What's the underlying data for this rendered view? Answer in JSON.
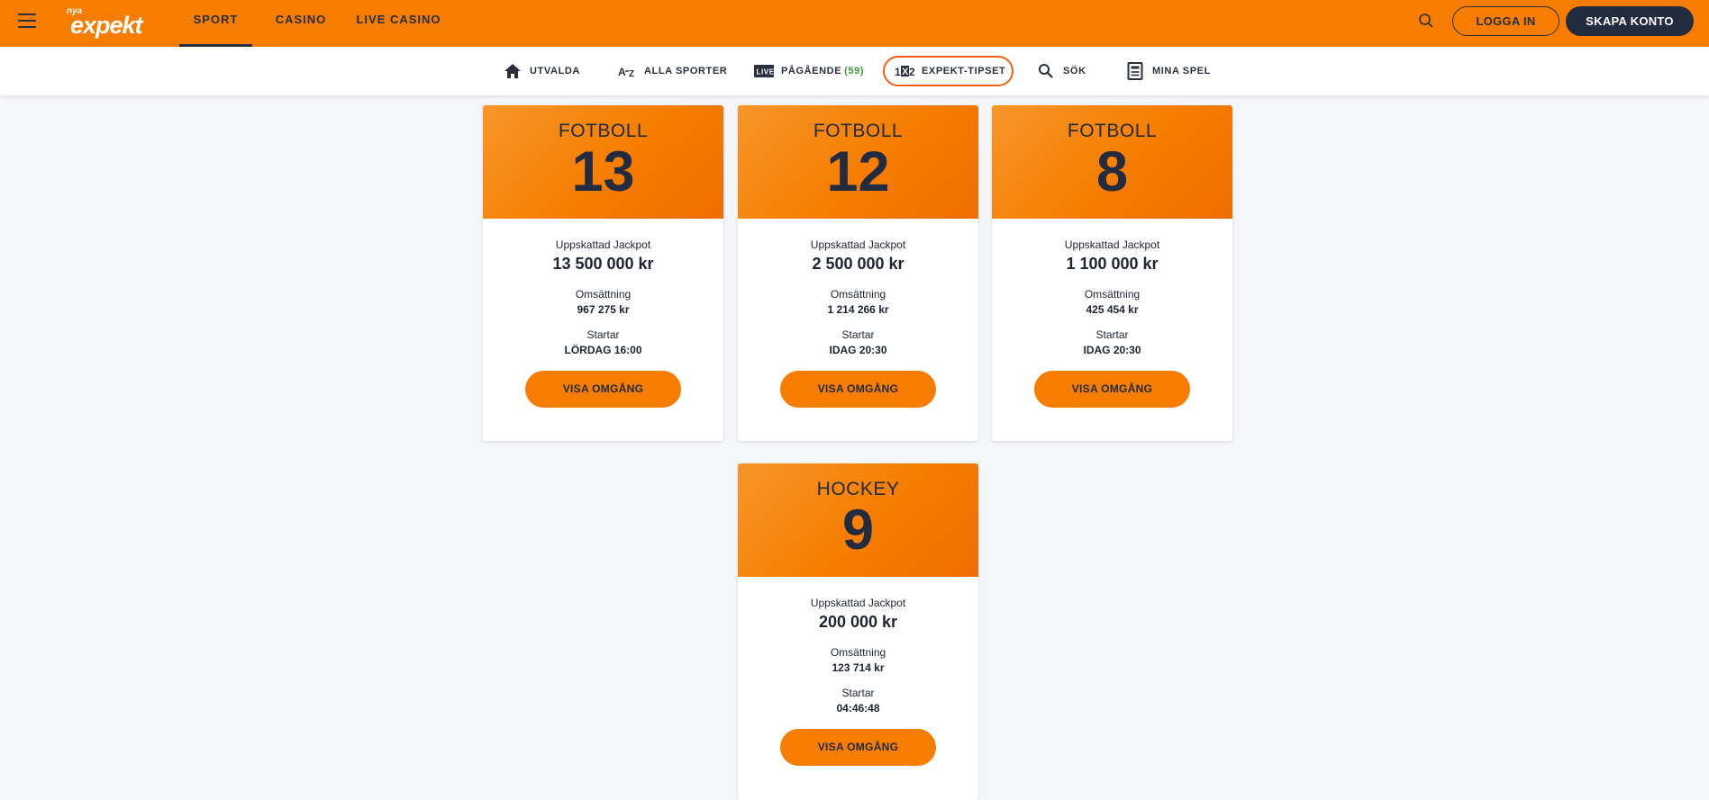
{
  "brand": {
    "prefix": "nya",
    "name": "expekt",
    "accent": "#f67d00",
    "dark": "#222b3f"
  },
  "header": {
    "tabs": [
      {
        "label": "SPORT",
        "active": true
      },
      {
        "label": "CASINO",
        "active": false
      },
      {
        "label": "LIVE CASINO",
        "active": false
      }
    ],
    "login_label": "LOGGA IN",
    "signup_label": "SKAPA KONTO"
  },
  "subnav": {
    "items": [
      {
        "label": "UTVALDA",
        "icon": "home-icon"
      },
      {
        "label": "ALLA SPORTER",
        "icon": "az-icon"
      },
      {
        "label": "PÅGÅENDE",
        "count": "(59)",
        "icon": "live-icon"
      },
      {
        "label": "EXPEKT-TIPSET",
        "icon": "1x2-icon",
        "active": true
      },
      {
        "label": "SÖK",
        "icon": "search-icon"
      },
      {
        "label": "MINA SPEL",
        "icon": "betslip-icon"
      }
    ]
  },
  "cards": [
    {
      "sport": "FOTBOLL",
      "number": "13",
      "jackpot_label": "Uppskattad Jackpot",
      "jackpot": "13 500 000 kr",
      "turnover_label": "Omsättning",
      "turnover": "967 275 kr",
      "start_label": "Startar",
      "start": "LÖRDAG 16:00",
      "button": "VISA OMGÅNG"
    },
    {
      "sport": "FOTBOLL",
      "number": "12",
      "jackpot_label": "Uppskattad Jackpot",
      "jackpot": "2 500 000 kr",
      "turnover_label": "Omsättning",
      "turnover": "1 214 266 kr",
      "start_label": "Startar",
      "start": "IDAG 20:30",
      "button": "VISA OMGÅNG"
    },
    {
      "sport": "FOTBOLL",
      "number": "8",
      "jackpot_label": "Uppskattad Jackpot",
      "jackpot": "1 100 000 kr",
      "turnover_label": "Omsättning",
      "turnover": "425 454 kr",
      "start_label": "Startar",
      "start": "IDAG 20:30",
      "button": "VISA OMGÅNG"
    },
    {
      "sport": "HOCKEY",
      "number": "9",
      "jackpot_label": "Uppskattad Jackpot",
      "jackpot": "200 000 kr",
      "turnover_label": "Omsättning",
      "turnover": "123 714 kr",
      "start_label": "Startar",
      "start": "04:46:48",
      "button": "VISA OMGÅNG"
    }
  ]
}
